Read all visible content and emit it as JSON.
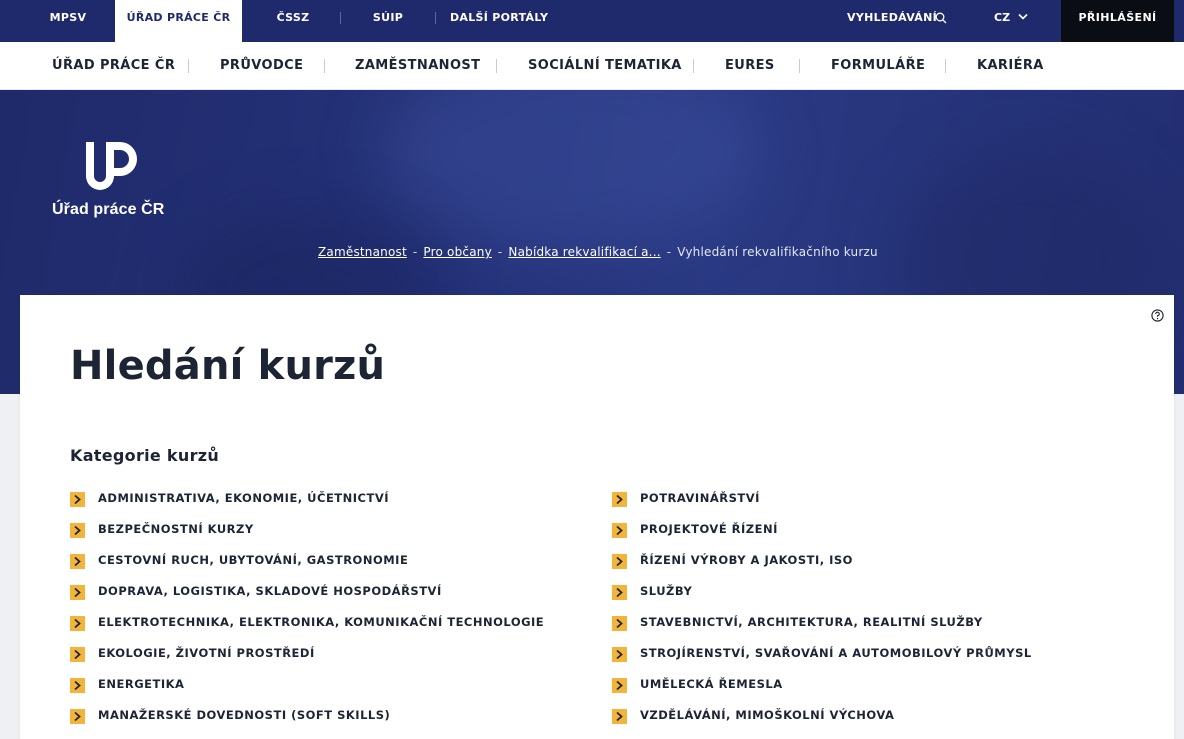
{
  "top_bar": {
    "portals": [
      "MPSV",
      "ÚŘAD PRÁCE ČR",
      "ČSSZ",
      "SÚIP",
      "DALŠÍ PORTÁLY"
    ],
    "search_label": "VYHLEDÁVÁNÍ",
    "language": "CZ",
    "login_label": "PŘIHLÁŠENÍ"
  },
  "main_nav": {
    "items": [
      "ÚŘAD PRÁCE ČR",
      "PRŮVODCE",
      "ZAMĚSTNANOST",
      "SOCIÁLNÍ TEMATIKA",
      "EURES",
      "FORMULÁŘE",
      "KARIÉRA"
    ]
  },
  "hero": {
    "logo_text": "Úřad práce ČR"
  },
  "breadcrumb": {
    "links": [
      "Zaměstnanost",
      "Pro občany",
      "Nabídka rekvalifikací a..."
    ],
    "separator": "-",
    "current": "Vyhledání rekvalifikačního kurzu"
  },
  "page": {
    "title": "Hledání kurzů",
    "category_heading": "Kategorie kurzů"
  },
  "categories": {
    "left": [
      "ADMINISTRATIVA, EKONOMIE, ÚČETNICTVÍ",
      "BEZPEČNOSTNÍ KURZY",
      "CESTOVNÍ RUCH, UBYTOVÁNÍ, GASTRONOMIE",
      "DOPRAVA, LOGISTIKA, SKLADOVÉ HOSPODÁŘSTVÍ",
      "ELEKTROTECHNIKA, ELEKTRONIKA, KOMUNIKAČNÍ TECHNOLOGIE",
      "EKOLOGIE, ŽIVOTNÍ PROSTŘEDÍ",
      "ENERGETIKA",
      "MANAŽERSKÉ DOVEDNOSTI (SOFT SKILLS)"
    ],
    "right": [
      "POTRAVINÁŘSTVÍ",
      "PROJEKTOVÉ ŘÍZENÍ",
      "ŘÍZENÍ VÝROBY A JAKOSTI, ISO",
      "SLUŽBY",
      "STAVEBNICTVÍ, ARCHITEKTURA, REALITNÍ SLUŽBY",
      "STROJÍRENSTVÍ, SVAŘOVÁNÍ A AUTOMOBILOVÝ PRŮMYSL",
      "UMĚLECKÁ ŘEMESLA",
      "VZDĚLÁVÁNÍ, MIMOŠKOLNÍ VÝCHOVA"
    ]
  },
  "colors": {
    "brand_navy": "#1f2a6c",
    "accent_orange": "#f2b43a",
    "login_black": "#0b0d14"
  },
  "icons": {
    "search": "search-icon",
    "language_dropdown": "chevron-down-icon",
    "category_bullet": "chevron-right-icon",
    "help": "question-circle-icon"
  }
}
